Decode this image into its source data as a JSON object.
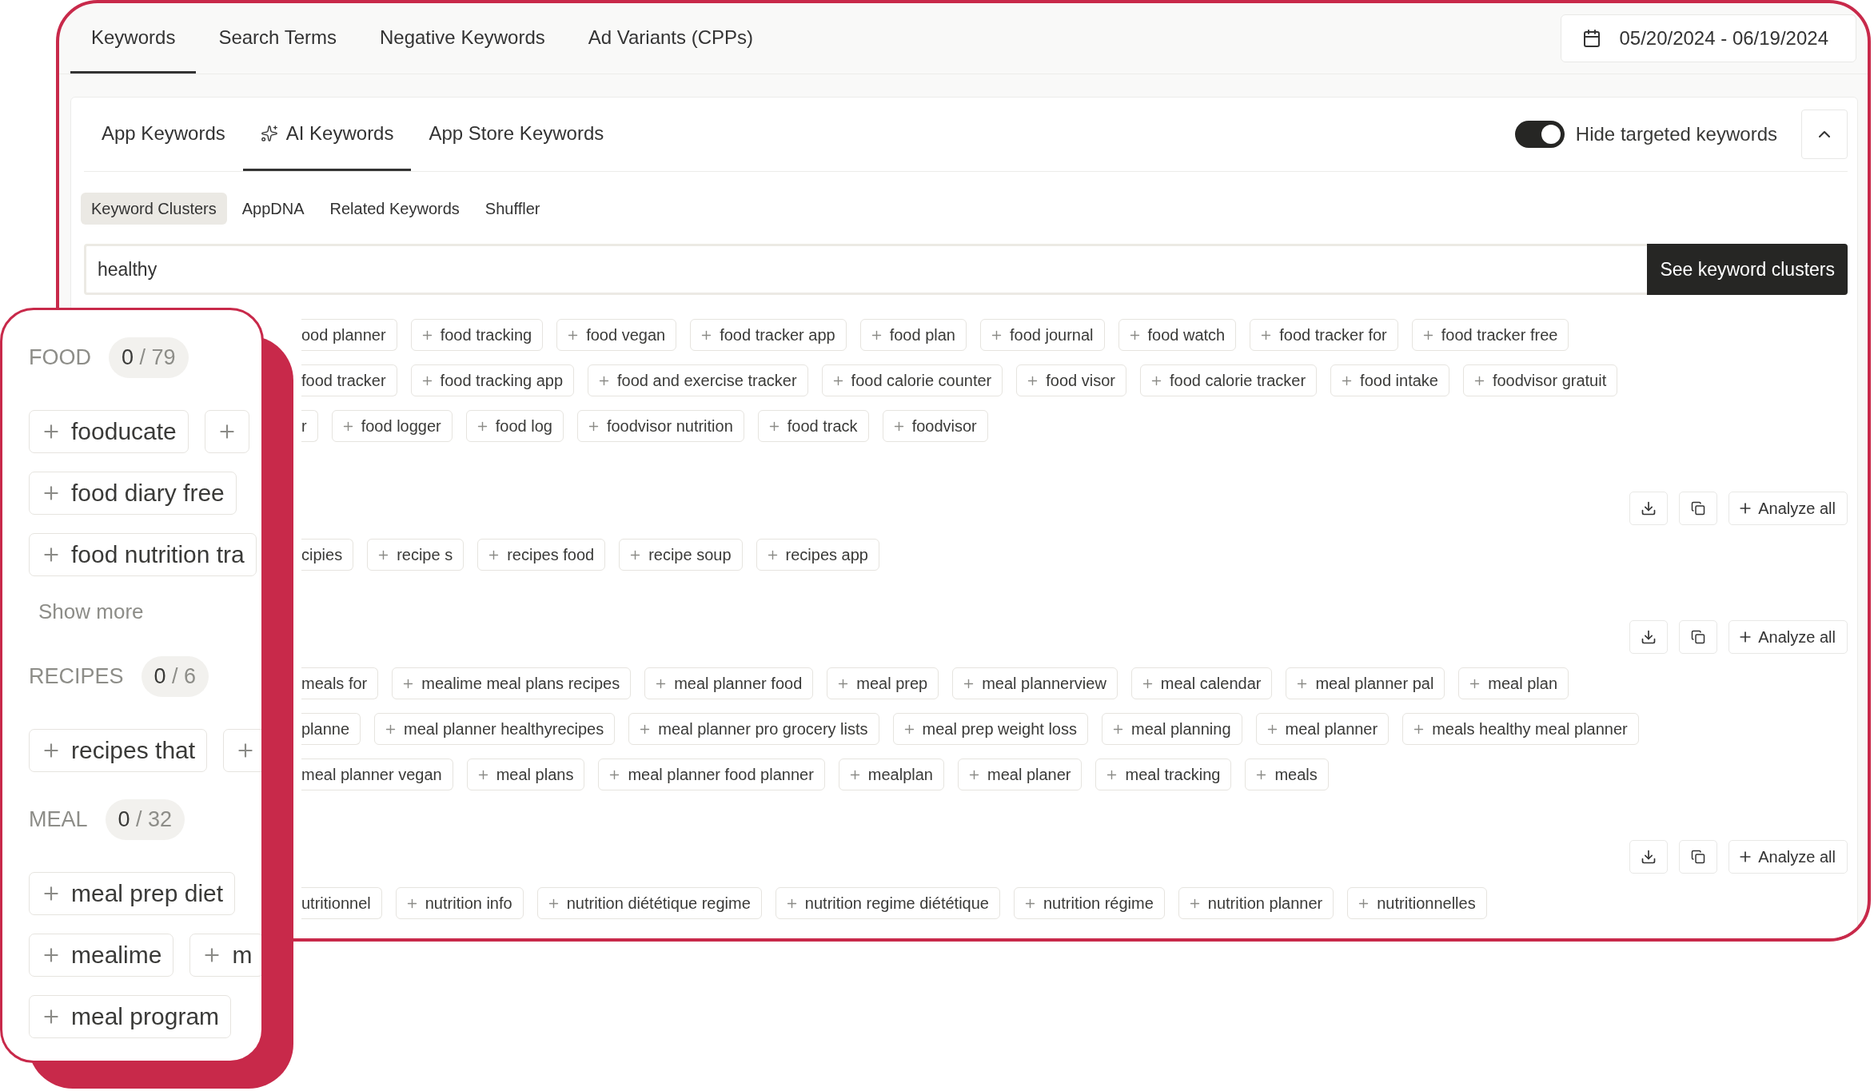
{
  "top_tabs": [
    {
      "label": "Keywords",
      "selected": true
    },
    {
      "label": "Search Terms",
      "selected": false
    },
    {
      "label": "Negative Keywords",
      "selected": false
    },
    {
      "label": "Ad Variants (CPPs)",
      "selected": false
    }
  ],
  "date_range": "05/20/2024 - 06/19/2024",
  "sub_tabs": [
    {
      "label": "App Keywords",
      "kind": "plain",
      "selected": false
    },
    {
      "label": "AI Keywords",
      "kind": "ai",
      "selected": true
    },
    {
      "label": "App Store Keywords",
      "kind": "plain",
      "selected": false
    }
  ],
  "hide_targeted": {
    "label": "Hide targeted keywords",
    "on": true
  },
  "pill_tabs": [
    {
      "label": "Keyword Clusters",
      "selected": true
    },
    {
      "label": "AppDNA",
      "selected": false
    },
    {
      "label": "Related Keywords",
      "selected": false
    },
    {
      "label": "Shuffler",
      "selected": false
    }
  ],
  "search": {
    "value": "healthy",
    "button": "See keyword clusters"
  },
  "clusters": [
    {
      "chip_rows": [
        [
          {
            "label": "ood planner",
            "kind": "cut"
          },
          {
            "label": "food tracking",
            "kind": "full"
          },
          {
            "label": "food vegan",
            "kind": "full"
          },
          {
            "label": "food tracker app",
            "kind": "full"
          },
          {
            "label": "food plan",
            "kind": "full"
          },
          {
            "label": "food journal",
            "kind": "full"
          },
          {
            "label": "food watch",
            "kind": "full"
          },
          {
            "label": "food tracker for",
            "kind": "full"
          },
          {
            "label": "food tracker free",
            "kind": "full"
          }
        ],
        [
          {
            "label": "food tracker",
            "kind": "cut"
          },
          {
            "label": "food tracking app",
            "kind": "full"
          },
          {
            "label": "food and exercise tracker",
            "kind": "full"
          },
          {
            "label": "food calorie counter",
            "kind": "full"
          },
          {
            "label": "food visor",
            "kind": "full"
          },
          {
            "label": "food calorie tracker",
            "kind": "full"
          },
          {
            "label": "food intake",
            "kind": "full"
          },
          {
            "label": "foodvisor gratuit",
            "kind": "full"
          }
        ],
        [
          {
            "label": "r",
            "kind": "cut"
          },
          {
            "label": "food logger",
            "kind": "full"
          },
          {
            "label": "food log",
            "kind": "full"
          },
          {
            "label": "foodvisor nutrition",
            "kind": "full"
          },
          {
            "label": "food track",
            "kind": "full"
          },
          {
            "label": "foodvisor",
            "kind": "full"
          }
        ]
      ]
    },
    {
      "analyze": "Analyze all",
      "chip_rows": [
        [
          {
            "label": "cipies",
            "kind": "cut"
          },
          {
            "label": "recipe s",
            "kind": "full"
          },
          {
            "label": "recipes food",
            "kind": "full"
          },
          {
            "label": "recipe soup",
            "kind": "full"
          },
          {
            "label": "recipes app",
            "kind": "full"
          }
        ]
      ]
    },
    {
      "analyze": "Analyze all",
      "chip_rows": [
        [
          {
            "label": "meals for",
            "kind": "cut"
          },
          {
            "label": "mealime meal plans recipes",
            "kind": "full"
          },
          {
            "label": "meal planner food",
            "kind": "full"
          },
          {
            "label": "meal prep",
            "kind": "full"
          },
          {
            "label": "meal plannerview",
            "kind": "full"
          },
          {
            "label": "meal calendar",
            "kind": "full"
          },
          {
            "label": "meal planner pal",
            "kind": "full"
          },
          {
            "label": "meal plan",
            "kind": "full"
          }
        ],
        [
          {
            "label": "planne",
            "kind": "cut"
          },
          {
            "label": "meal planner healthyrecipes",
            "kind": "full"
          },
          {
            "label": "meal planner pro grocery lists",
            "kind": "full"
          },
          {
            "label": "meal prep weight loss",
            "kind": "full"
          },
          {
            "label": "meal planning",
            "kind": "full"
          },
          {
            "label": "meal planner",
            "kind": "full"
          },
          {
            "label": "meals healthy meal planner",
            "kind": "full"
          }
        ],
        [
          {
            "label": "meal planner vegan",
            "kind": "cut"
          },
          {
            "label": "meal plans",
            "kind": "full"
          },
          {
            "label": "meal planner food planner",
            "kind": "full"
          },
          {
            "label": "mealplan",
            "kind": "full"
          },
          {
            "label": "meal planer",
            "kind": "full"
          },
          {
            "label": "meal tracking",
            "kind": "full"
          },
          {
            "label": "meals",
            "kind": "full"
          }
        ]
      ]
    },
    {
      "analyze": "Analyze all",
      "chip_rows": [
        [
          {
            "label": "utritionnel",
            "kind": "cut"
          },
          {
            "label": "nutrition info",
            "kind": "full"
          },
          {
            "label": "nutrition diététique regime",
            "kind": "full"
          },
          {
            "label": "nutrition regime diététique",
            "kind": "full"
          },
          {
            "label": "nutrition régime",
            "kind": "full"
          },
          {
            "label": "nutrition planner",
            "kind": "full"
          },
          {
            "label": "nutritionnelles",
            "kind": "full"
          }
        ]
      ]
    }
  ],
  "zoom_card": {
    "groups": [
      {
        "name": "FOOD",
        "count": "**0** / 79",
        "chip_rows": [
          [
            {
              "label": "fooducate",
              "kind": "full"
            },
            {
              "kind": "stub"
            }
          ],
          [
            {
              "label": "food diary free",
              "kind": "full"
            }
          ],
          [
            {
              "label": "food nutrition tra",
              "kind": "full"
            }
          ]
        ],
        "show_more": "Show more"
      },
      {
        "name": "RECIPES",
        "count": "**0** / 6",
        "chip_rows": [
          [
            {
              "label": "recipes that",
              "kind": "full"
            },
            {
              "kind": "stub"
            }
          ]
        ]
      },
      {
        "name": "MEAL",
        "count": "**0** / 32",
        "chip_rows": [
          [
            {
              "label": "meal prep diet",
              "kind": "full"
            }
          ],
          [
            {
              "label": "mealime",
              "kind": "full"
            },
            {
              "label": "m",
              "kind": "full"
            }
          ],
          [
            {
              "label": "meal program",
              "kind": "full"
            }
          ]
        ]
      }
    ]
  }
}
